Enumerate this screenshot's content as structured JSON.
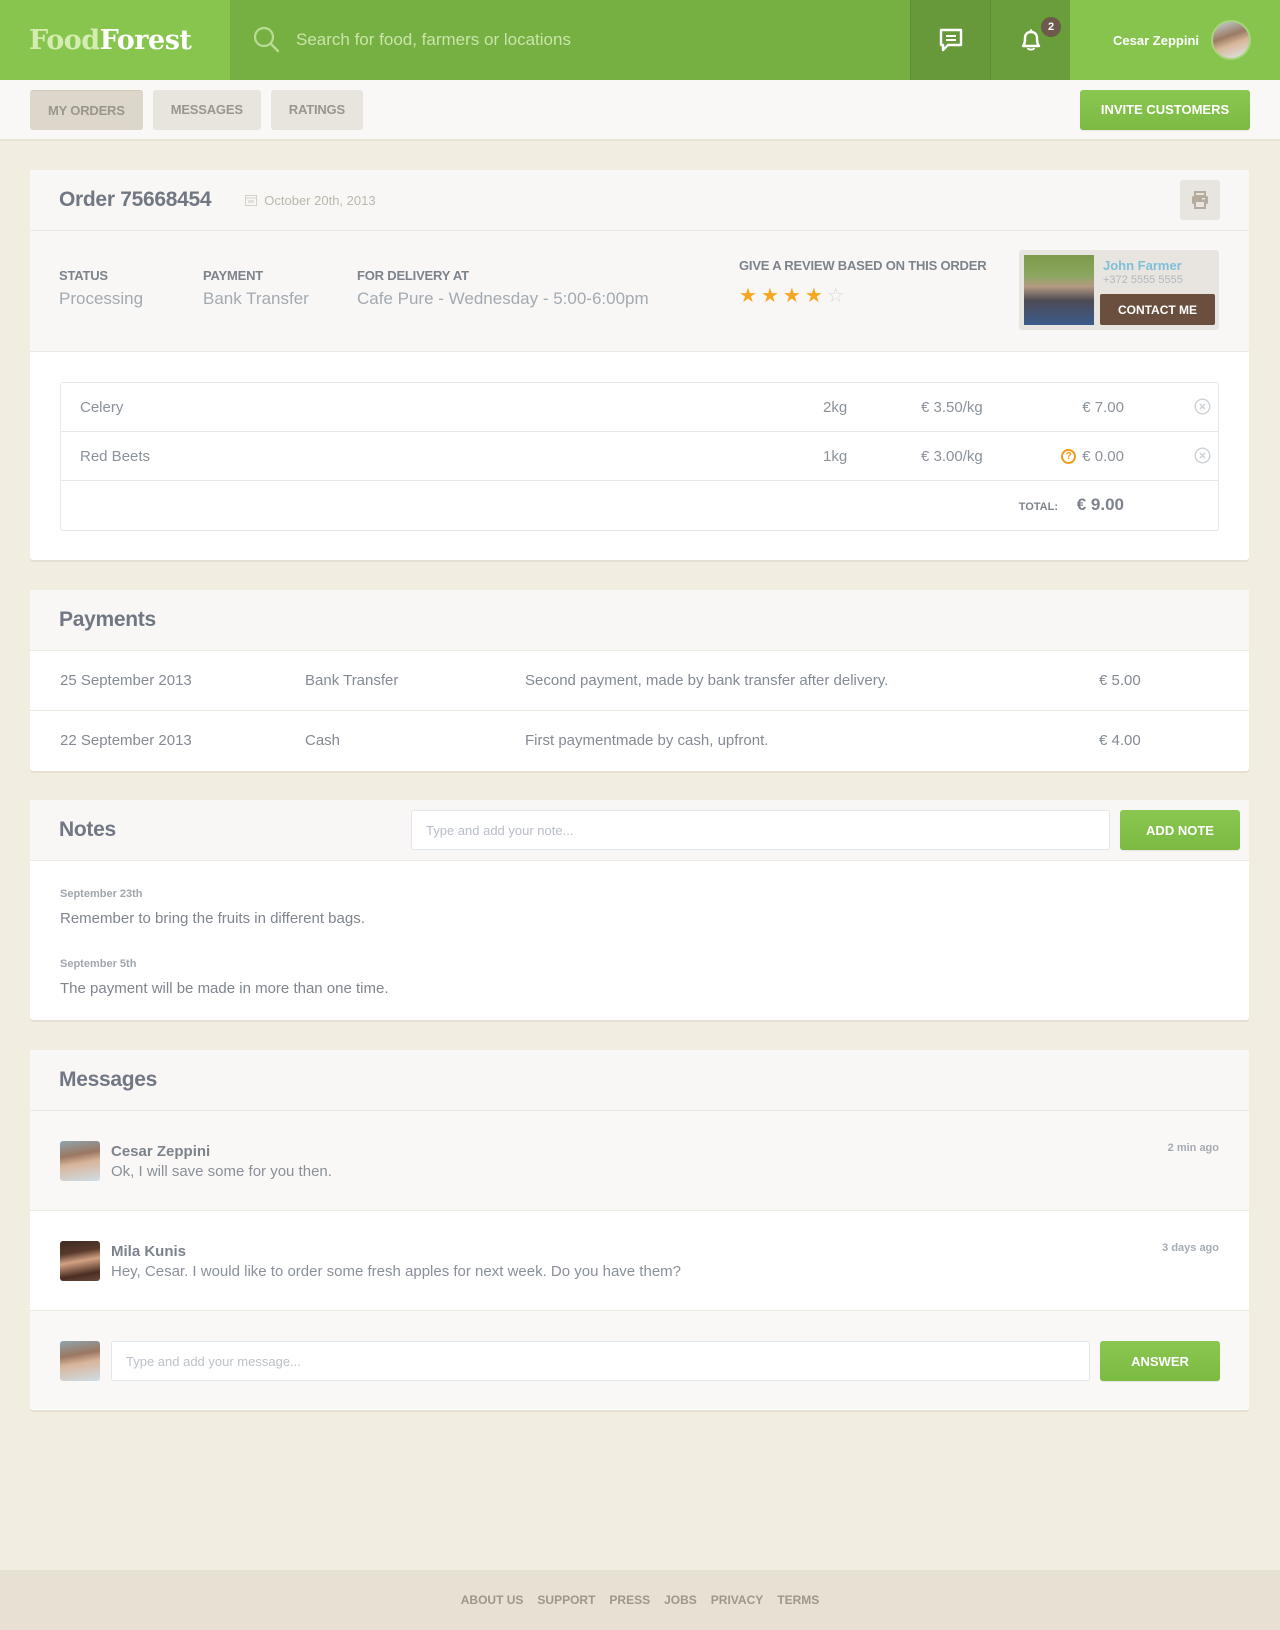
{
  "header": {
    "logo_part1": "Food",
    "logo_part2": "Forest",
    "search_placeholder": "Search for food, farmers or locations",
    "notification_count": "2",
    "user_name": "Cesar Zeppini"
  },
  "subnav": {
    "tabs": [
      {
        "label": "MY ORDERS",
        "active": true
      },
      {
        "label": "MESSAGES",
        "active": false
      },
      {
        "label": "RATINGS",
        "active": false
      }
    ],
    "invite_label": "INVITE CUSTOMERS"
  },
  "order": {
    "title": "Order 75668454",
    "date": "October 20th, 2013",
    "status_label": "STATUS",
    "status_value": "Processing",
    "payment_label": "PAYMENT",
    "payment_value": "Bank Transfer",
    "delivery_label": "FOR DELIVERY AT",
    "delivery_value": "Cafe Pure - Wednesday - 5:00-6:00pm",
    "review_label": "GIVE A REVIEW BASED ON THIS ORDER",
    "rating": 4,
    "rating_max": 5,
    "farmer": {
      "name": "John Farmer",
      "phone": "+372 5555 5555",
      "contact_label": "CONTACT ME"
    },
    "items": [
      {
        "name": "Celery",
        "qty": "2kg",
        "unit_price": "€ 3.50/kg",
        "total": "€ 7.00",
        "warning": false
      },
      {
        "name": "Red Beets",
        "qty": "1kg",
        "unit_price": "€ 3.00/kg",
        "total": "€ 0.00",
        "warning": true
      }
    ],
    "total_label": "TOTAL:",
    "total_value": "€ 9.00"
  },
  "payments": {
    "title": "Payments",
    "rows": [
      {
        "date": "25 September 2013",
        "method": "Bank Transfer",
        "description": "Second payment, made by bank transfer after delivery.",
        "amount": "€ 5.00"
      },
      {
        "date": "22 September 2013",
        "method": "Cash",
        "description": "First paymentmade by cash, upfront.",
        "amount": "€ 4.00"
      }
    ]
  },
  "notes": {
    "title": "Notes",
    "input_placeholder": "Type and add your note...",
    "add_label": "ADD NOTE",
    "items": [
      {
        "date": "September 23th",
        "text": "Remember to bring the fruits in different bags."
      },
      {
        "date": "September 5th",
        "text": "The payment will be made in more than one time."
      }
    ]
  },
  "messages": {
    "title": "Messages",
    "items": [
      {
        "author": "Cesar Zeppini",
        "text": "Ok, I will save some for you then.",
        "time": "2 min ago"
      },
      {
        "author": "Mila Kunis",
        "text": "Hey, Cesar. I would like to order some fresh apples for next week. Do you have them?",
        "time": "3 days ago"
      }
    ],
    "input_placeholder": "Type and add your message...",
    "answer_label": "ANSWER"
  },
  "footer": {
    "links": [
      "ABOUT US",
      "SUPPORT",
      "PRESS",
      "JOBS",
      "PRIVACY",
      "TERMS"
    ]
  },
  "colors": {
    "brand_green": "#86c44e",
    "star_active": "#f5a623",
    "star_inactive": "#d8d8d8",
    "contact_brown": "#6a4f3e",
    "warning_orange": "#f09a1a"
  }
}
